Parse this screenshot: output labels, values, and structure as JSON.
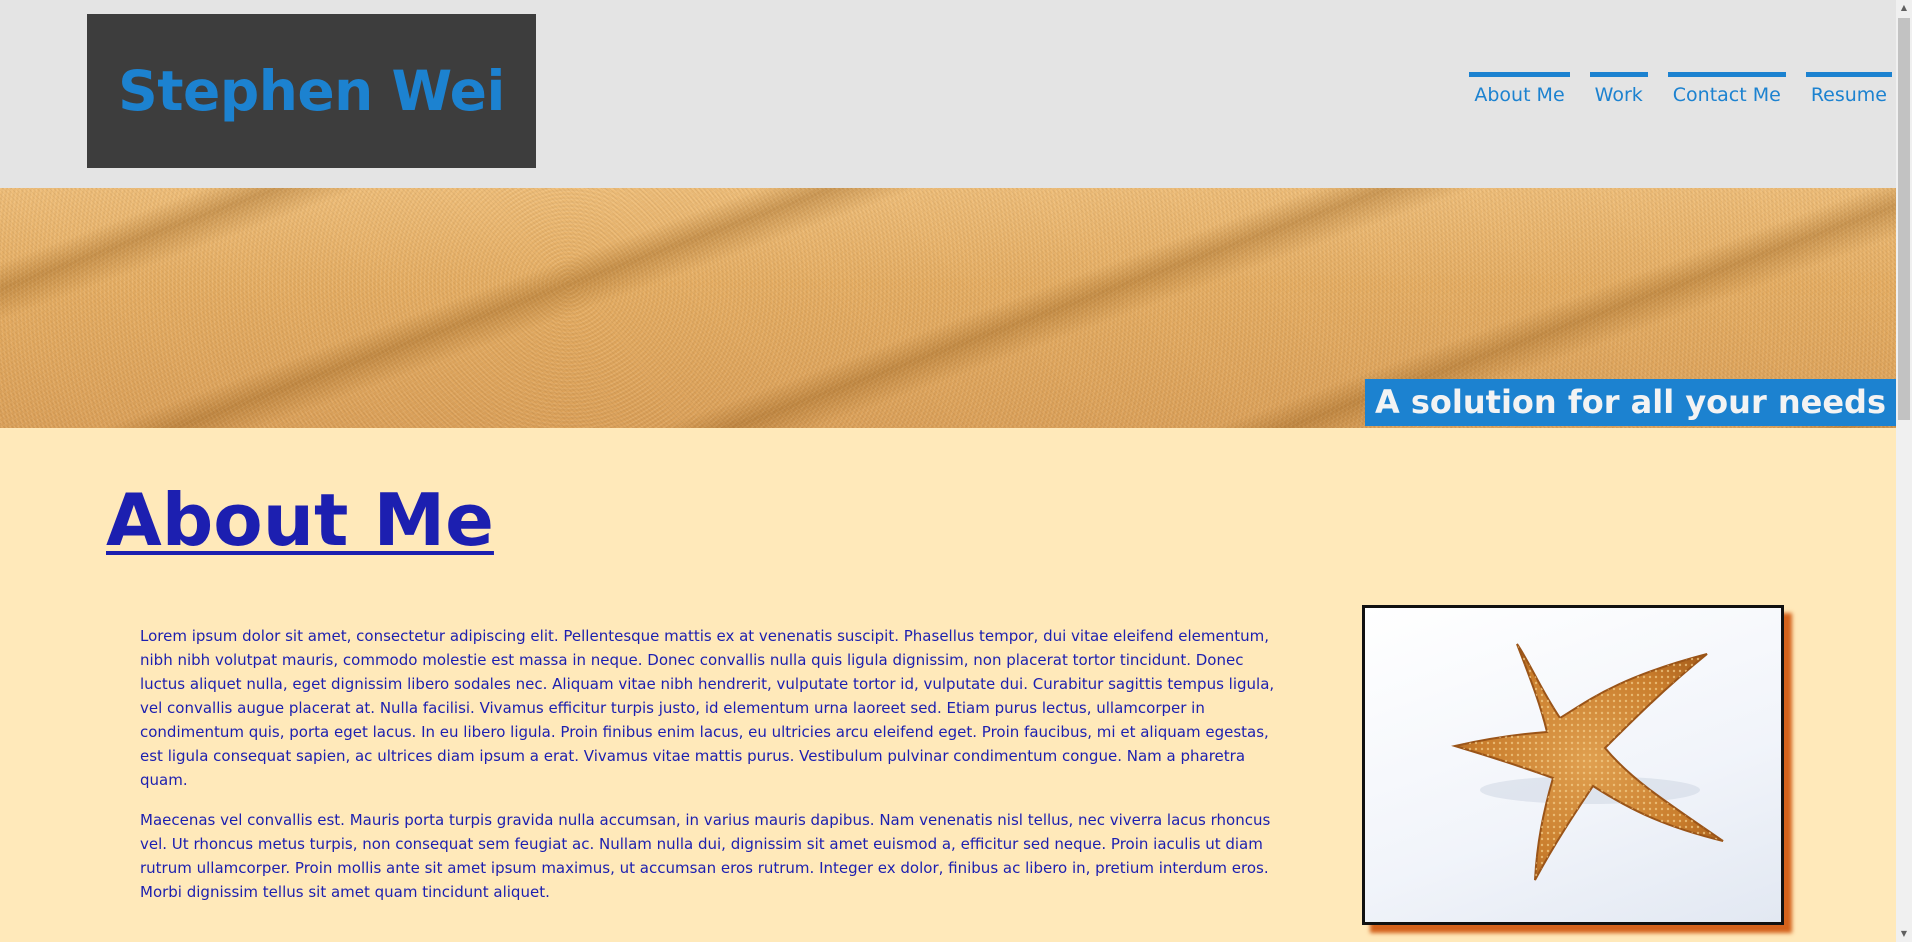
{
  "header": {
    "logo": "Stephen Wei",
    "nav": [
      {
        "label": "About Me"
      },
      {
        "label": "Work"
      },
      {
        "label": "Contact Me"
      },
      {
        "label": "Resume"
      }
    ]
  },
  "hero": {
    "tagline": "A solution for all your needs"
  },
  "main": {
    "heading": "About Me",
    "paragraphs": [
      "Lorem ipsum dolor sit amet, consectetur adipiscing elit. Pellentesque mattis ex at venenatis suscipit. Phasellus tempor, dui vitae eleifend elementum, nibh nibh volutpat mauris, commodo molestie est massa in neque. Donec convallis nulla quis ligula dignissim, non placerat tortor tincidunt. Donec luctus aliquet nulla, eget dignissim libero sodales nec. Aliquam vitae nibh hendrerit, vulputate tortor id, vulputate dui. Curabitur sagittis tempus ligula, vel convallis augue placerat at. Nulla facilisi. Vivamus efficitur turpis justo, id elementum urna laoreet sed. Etiam purus lectus, ullamcorper in condimentum quis, porta eget lacus. In eu libero ligula. Proin finibus enim lacus, eu ultricies arcu eleifend eget. Proin faucibus, mi et aliquam egestas, est ligula consequat sapien, ac ultrices diam ipsum a erat. Vivamus vitae mattis purus. Vestibulum pulvinar condimentum congue. Nam a pharetra quam.",
      "Maecenas vel convallis est. Mauris porta turpis gravida nulla accumsan, in varius mauris dapibus. Nam venenatis nisl tellus, nec viverra lacus rhoncus vel. Ut rhoncus metus turpis, non consequat sem feugiat ac. Nullam nulla dui, dignissim sit amet euismod a, efficitur sed neque. Proin iaculis ut diam rutrum ullamcorper. Proin mollis ante sit amet ipsum maximus, ut accumsan eros rutrum. Integer ex dolor, finibus ac libero in, pretium interdum eros. Morbi dignissim tellus sit amet quam tincidunt aliquet."
    ],
    "image_subject": "starfish-photo"
  },
  "colors": {
    "accent": "#1c82d0",
    "header_bg": "#e4e4e4",
    "logo_bg": "#3d3d3d",
    "content_bg": "#ffe9ba",
    "text": "#1c1fb0",
    "image_shadow": "#d4621c"
  }
}
